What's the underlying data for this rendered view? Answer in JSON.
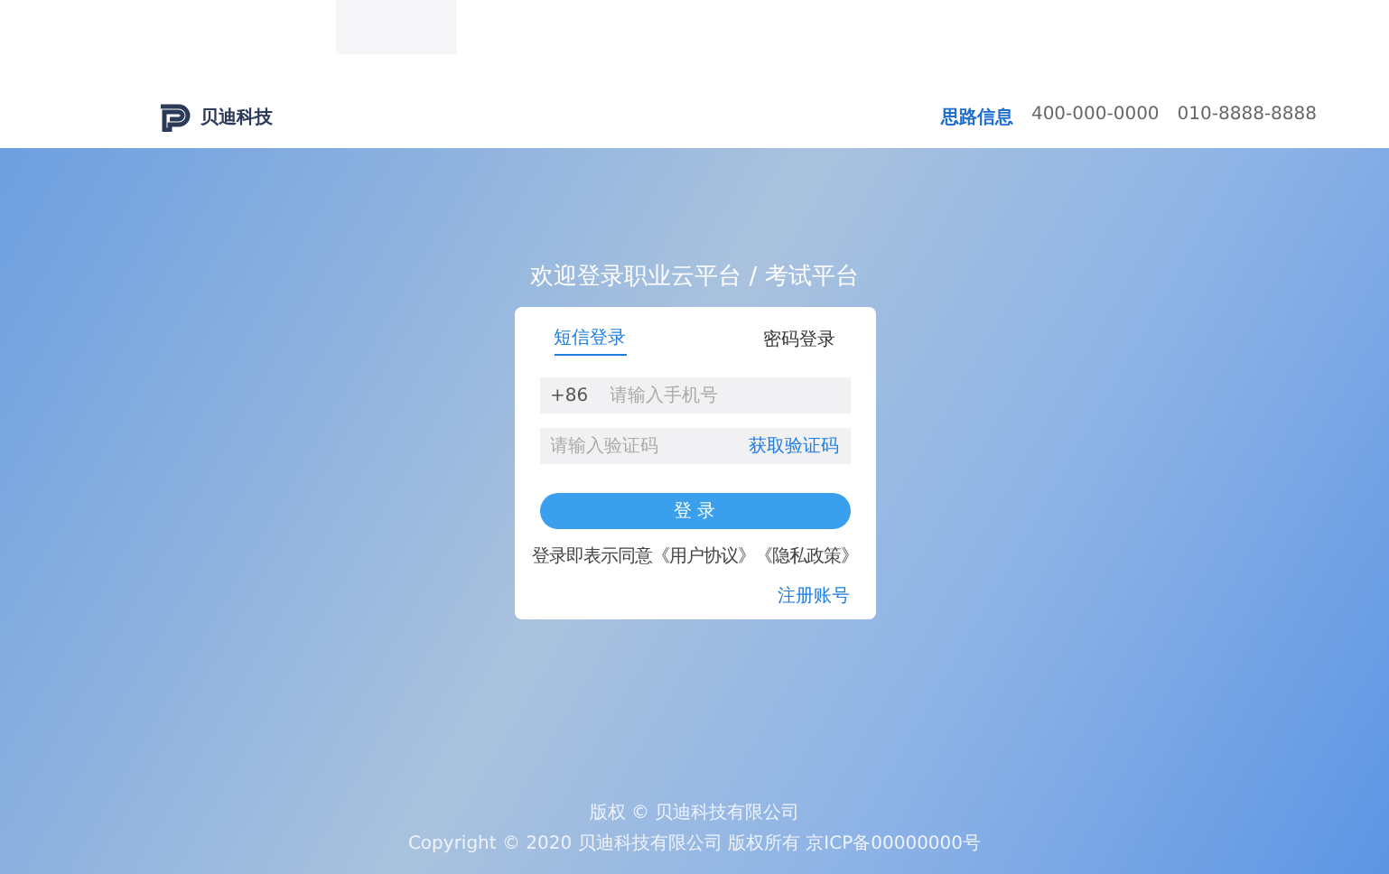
{
  "header": {
    "logo_text": "贝迪科技",
    "links": [
      {
        "label": "思路信息",
        "selected": true
      },
      {
        "label": "400-000-0000",
        "selected": false
      },
      {
        "label": "010-8888-8888",
        "selected": false
      }
    ]
  },
  "title": "欢迎登录职业云平台 / 考试平台",
  "login": {
    "tabs": [
      {
        "label": "短信登录",
        "selected": true
      },
      {
        "label": "密码登录",
        "selected": false
      }
    ],
    "phone_prefix": "+86",
    "phone": {
      "placeholder": "请输入手机号"
    },
    "code": {
      "placeholder": "请输入验证码"
    },
    "code_button": "获取验证码",
    "submit": "登 录",
    "agreement": "登录即表示同意《用户协议》《隐私政策》",
    "register": "注册账号"
  },
  "footer": [
    "版权 © 贝迪科技有限公司",
    "Copyright © 2020 贝迪科技有限公司 版权所有 京ICP备00000000号"
  ]
}
